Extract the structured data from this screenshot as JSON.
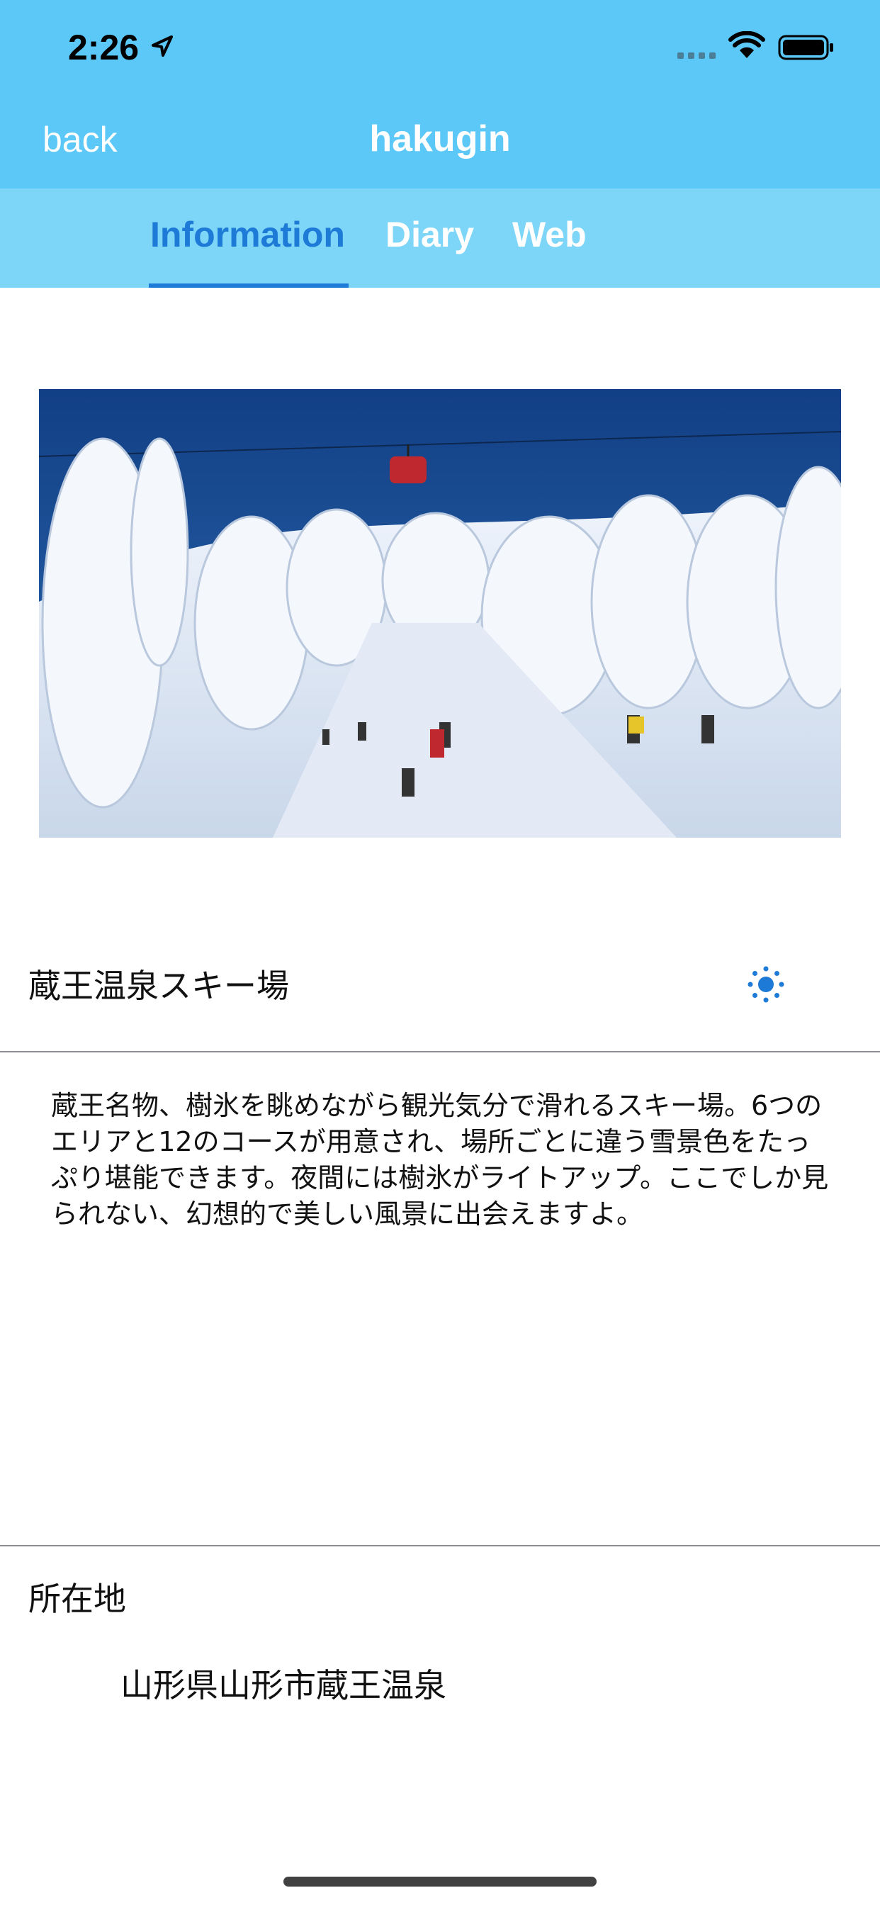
{
  "status_bar": {
    "time": "2:26"
  },
  "nav": {
    "back_label": "back",
    "title": "hakugin"
  },
  "tabs": [
    {
      "label": "Information",
      "active": true
    },
    {
      "label": "Diary",
      "active": false
    },
    {
      "label": "Web",
      "active": false
    }
  ],
  "spot": {
    "name": "蔵王温泉スキー場",
    "weather_icon": "sun-icon",
    "description": "蔵王名物、樹氷を眺めながら観光気分で滑れるスキー場。6つのエリアと12のコースが用意され、場所ごとに違う雪景色をたっぷり堪能できます。夜間には樹氷がライトアップ。ここでしか見られない、幻想的で美しい風景に出会えますよ。"
  },
  "location": {
    "label": "所在地",
    "address": "山形県山形市蔵王温泉"
  },
  "colors": {
    "header": "#5cc8f7",
    "tab_bar": "#7dd5f8",
    "accent": "#1d7ad6"
  }
}
